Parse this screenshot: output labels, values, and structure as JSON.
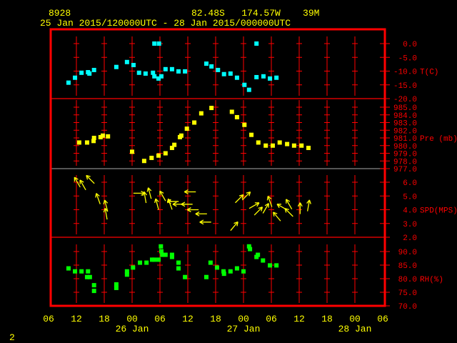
{
  "chart_data": {
    "type": "scatter",
    "header": {
      "station": "8928",
      "location": "82.48S   174.57W    39M",
      "period": "25 Jan 2015/120000UTC - 28 Jan 2015/000000UTC"
    },
    "x_ticks": [
      "06",
      "12",
      "18",
      "00",
      "06",
      "12",
      "18",
      "00",
      "06",
      "12",
      "18",
      "00",
      "06"
    ],
    "x_dates": [
      "26 Jan",
      "27 Jan",
      "28 Jan"
    ],
    "x_units": "hours since 25 Jan 2015 00UTC",
    "xlim": [
      6,
      78
    ],
    "footer": "2",
    "colors": {
      "frame": "#ff0000",
      "text": "#ffff00",
      "temp": "#00ffff",
      "pres": "#ffff00",
      "wind": "#ffff00",
      "rh": "#00ff00"
    },
    "panels": [
      {
        "name": "temperature",
        "label": "T(C)",
        "ticks": [
          "0.0",
          "-5.0",
          "-10.0",
          "-15.0",
          "-20.0"
        ],
        "ylim": [
          -20,
          0
        ],
        "points": [
          [
            10.3,
            -14.2
          ],
          [
            11.7,
            -12.4
          ],
          [
            13.1,
            -10.6
          ],
          [
            14.5,
            -10.4
          ],
          [
            14.8,
            -10.9
          ],
          [
            15.8,
            -9.6
          ],
          [
            20.6,
            -8.5
          ],
          [
            22.9,
            -6.7
          ],
          [
            24.3,
            -7.8
          ],
          [
            25.5,
            -10.6
          ],
          [
            26.9,
            -10.9
          ],
          [
            28.5,
            -10.6
          ],
          [
            28.8,
            -11.9
          ],
          [
            29.7,
            -12.7
          ],
          [
            30.3,
            -11.9
          ],
          [
            31.2,
            -9.3
          ],
          [
            32.6,
            -9.3
          ],
          [
            34.0,
            -10.1
          ],
          [
            35.4,
            -10.1
          ],
          [
            28.8,
            0.0
          ],
          [
            29.8,
            0.0
          ],
          [
            40.0,
            -7.3
          ],
          [
            41.1,
            -8.3
          ],
          [
            42.5,
            -9.6
          ],
          [
            43.8,
            -11.1
          ],
          [
            45.2,
            -10.9
          ],
          [
            46.6,
            -12.4
          ],
          [
            48.2,
            -15.0
          ],
          [
            49.2,
            -16.8
          ],
          [
            50.8,
            -12.2
          ],
          [
            52.3,
            -11.9
          ],
          [
            53.7,
            -12.7
          ],
          [
            55.1,
            -12.4
          ],
          [
            50.8,
            0.0
          ]
        ]
      },
      {
        "name": "pressure",
        "label": "Pre (mb)",
        "ticks": [
          "985.0",
          "984.0",
          "983.0",
          "982.0",
          "981.0",
          "980.0",
          "979.0",
          "978.0",
          "977.0"
        ],
        "ylim": [
          977,
          985
        ],
        "points": [
          [
            12.6,
            980.4
          ],
          [
            14.3,
            980.4
          ],
          [
            15.7,
            980.6
          ],
          [
            15.8,
            981.0
          ],
          [
            17.2,
            981.1
          ],
          [
            17.7,
            981.3
          ],
          [
            18.8,
            981.2
          ],
          [
            24.0,
            979.2
          ],
          [
            26.6,
            978.0
          ],
          [
            28.2,
            978.4
          ],
          [
            29.7,
            978.7
          ],
          [
            31.2,
            979.0
          ],
          [
            32.6,
            979.7
          ],
          [
            33.1,
            980.1
          ],
          [
            34.3,
            981.1
          ],
          [
            34.6,
            981.3
          ],
          [
            35.8,
            982.2
          ],
          [
            37.4,
            983.0
          ],
          [
            38.9,
            984.2
          ],
          [
            41.1,
            984.9
          ],
          [
            45.5,
            984.4
          ],
          [
            46.6,
            983.7
          ],
          [
            48.2,
            982.7
          ],
          [
            49.7,
            981.4
          ],
          [
            51.2,
            980.4
          ],
          [
            52.8,
            980.0
          ],
          [
            54.3,
            980.0
          ],
          [
            55.8,
            980.4
          ],
          [
            57.4,
            980.2
          ],
          [
            58.9,
            980.0
          ],
          [
            60.5,
            980.0
          ],
          [
            62.0,
            979.7
          ]
        ]
      },
      {
        "name": "wind",
        "label": "SPD(MPS)",
        "ticks": [
          "6.0",
          "5.0",
          "4.0",
          "3.0",
          "2.0"
        ],
        "ylim": [
          2,
          6.5
        ],
        "points": [
          [
            12.2,
            6.0,
            -30
          ],
          [
            13.4,
            5.8,
            -30
          ],
          [
            15.0,
            6.2,
            -45
          ],
          [
            16.7,
            4.8,
            -20
          ],
          [
            18.4,
            4.3,
            -15
          ],
          [
            18.4,
            3.7,
            -10
          ],
          [
            25.5,
            5.2,
            90
          ],
          [
            26.8,
            4.9,
            -10
          ],
          [
            27.8,
            5.2,
            -15
          ],
          [
            29.4,
            4.4,
            -15
          ],
          [
            30.6,
            5.0,
            -30
          ],
          [
            32.2,
            4.4,
            -20
          ],
          [
            32.8,
            4.6,
            -90
          ],
          [
            34.0,
            4.4,
            -90
          ],
          [
            35.8,
            4.4,
            -90
          ],
          [
            36.5,
            5.3,
            -90
          ],
          [
            37.1,
            4.0,
            -90
          ],
          [
            38.9,
            3.7,
            -90
          ],
          [
            39.8,
            3.1,
            -90
          ],
          [
            47.1,
            4.8,
            45
          ],
          [
            48.6,
            5.0,
            45
          ],
          [
            46.0,
            2.8,
            40
          ],
          [
            50.3,
            4.3,
            60
          ],
          [
            51.2,
            3.9,
            45
          ],
          [
            52.8,
            4.1,
            30
          ],
          [
            53.7,
            4.6,
            -20
          ],
          [
            55.2,
            3.5,
            -40
          ],
          [
            56.3,
            4.2,
            -60
          ],
          [
            57.8,
            4.4,
            -30
          ],
          [
            57.8,
            3.8,
            -45
          ],
          [
            60.2,
            4.1,
            0
          ],
          [
            62.0,
            4.3,
            10
          ]
        ]
      },
      {
        "name": "humidity",
        "label": "RH(%)",
        "ticks": [
          "90.0",
          "85.0",
          "80.0",
          "75.0",
          "70.0"
        ],
        "ylim": [
          70,
          90
        ],
        "points": [
          [
            10.3,
            83.8
          ],
          [
            11.7,
            82.7
          ],
          [
            13.1,
            82.7
          ],
          [
            14.5,
            82.7
          ],
          [
            14.3,
            80.6
          ],
          [
            14.9,
            80.6
          ],
          [
            15.8,
            77.6
          ],
          [
            15.8,
            75.5
          ],
          [
            20.6,
            76.6
          ],
          [
            20.6,
            77.9
          ],
          [
            22.9,
            81.5
          ],
          [
            22.9,
            82.7
          ],
          [
            24.2,
            84.1
          ],
          [
            25.7,
            85.9
          ],
          [
            27.1,
            85.9
          ],
          [
            28.3,
            87.0
          ],
          [
            28.8,
            87.0
          ],
          [
            29.7,
            87.0
          ],
          [
            30.2,
            91.9
          ],
          [
            30.3,
            90.1
          ],
          [
            30.5,
            88.8
          ],
          [
            31.2,
            88.8
          ],
          [
            32.6,
            88.8
          ],
          [
            32.6,
            88.0
          ],
          [
            34.0,
            85.9
          ],
          [
            34.0,
            83.8
          ],
          [
            35.4,
            80.6
          ],
          [
            40.0,
            80.6
          ],
          [
            40.9,
            85.9
          ],
          [
            42.3,
            84.1
          ],
          [
            43.7,
            82.7
          ],
          [
            43.8,
            81.8
          ],
          [
            45.2,
            82.7
          ],
          [
            46.6,
            83.8
          ],
          [
            48.0,
            82.7
          ],
          [
            49.2,
            91.9
          ],
          [
            49.4,
            90.9
          ],
          [
            50.8,
            88.0
          ],
          [
            51.1,
            88.8
          ],
          [
            52.2,
            86.7
          ],
          [
            53.7,
            84.9
          ],
          [
            55.1,
            84.9
          ]
        ]
      }
    ]
  }
}
